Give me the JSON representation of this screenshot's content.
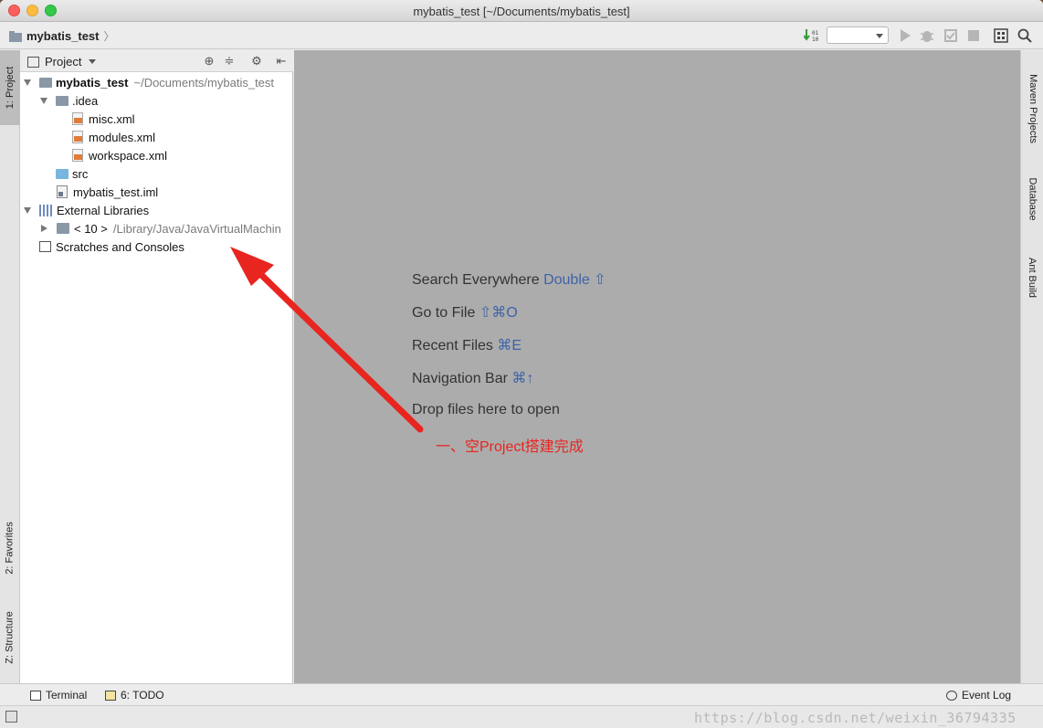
{
  "window": {
    "title": "mybatis_test [~/Documents/mybatis_test]"
  },
  "navbar": {
    "crumb": "mybatis_test",
    "run_config_value": ""
  },
  "left_stripe": {
    "project_tab": "1: Project",
    "favorites_tab": "2: Favorites",
    "structure_tab": "Z: Structure"
  },
  "right_stripe": {
    "maven_tab": "Maven Projects",
    "database_tab": "Database",
    "ant_tab": "Ant Build"
  },
  "project_panel": {
    "title": "Project",
    "tree": [
      {
        "label": "mybatis_test",
        "suffix": "~/Documents/mybatis_test"
      },
      {
        "label": ".idea"
      },
      {
        "label": "misc.xml"
      },
      {
        "label": "modules.xml"
      },
      {
        "label": "workspace.xml"
      },
      {
        "label": "src"
      },
      {
        "label": "mybatis_test.iml"
      },
      {
        "label": "External Libraries"
      },
      {
        "label": "< 10 >",
        "suffix": "/Library/Java/JavaVirtualMachin"
      },
      {
        "label": "Scratches and Consoles"
      }
    ]
  },
  "editor": {
    "hints": [
      {
        "text": "Search Everywhere",
        "key": "Double ⇧"
      },
      {
        "text": "Go to File",
        "key": "⇧⌘O"
      },
      {
        "text": "Recent Files",
        "key": "⌘E"
      },
      {
        "text": "Navigation Bar",
        "key": "⌘↑"
      },
      {
        "text": "Drop files here to open",
        "key": ""
      }
    ],
    "annotation": "一、空Project搭建完成",
    "annotation_color": "#e8251f"
  },
  "bottom_bar": {
    "terminal": "Terminal",
    "todo": "6: TODO",
    "event_log": "Event Log"
  },
  "status_bar": {
    "watermark": "https://blog.csdn.net/weixin_36794335"
  }
}
